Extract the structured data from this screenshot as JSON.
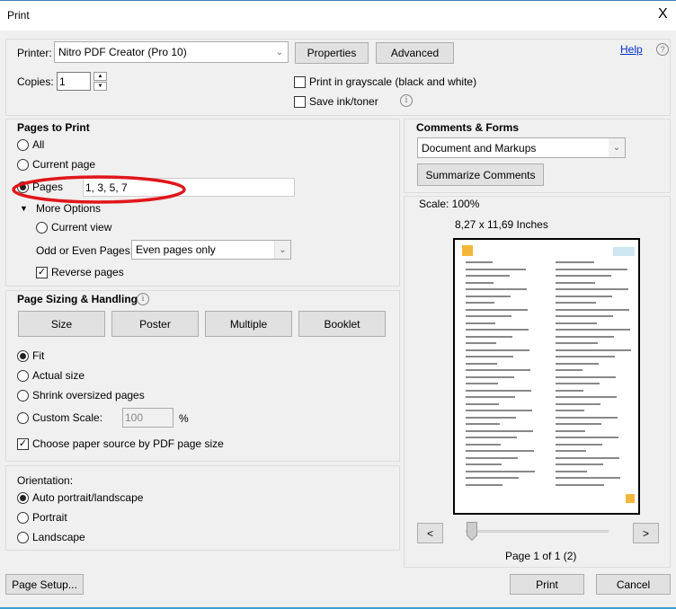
{
  "window": {
    "title": "Print",
    "close": "X"
  },
  "printer": {
    "label": "Printer:",
    "value": "Nitro PDF Creator (Pro 10)",
    "properties": "Properties",
    "advanced": "Advanced",
    "help": "Help"
  },
  "copies": {
    "label": "Copies:",
    "value": "1"
  },
  "options": {
    "grayscale": {
      "label": "Print in grayscale (black and white)",
      "checked": false
    },
    "save_ink": {
      "label": "Save ink/toner",
      "checked": false
    }
  },
  "pages_to_print": {
    "title": "Pages to Print",
    "all": "All",
    "current_page": "Current page",
    "pages": "Pages",
    "pages_value": "1, 3, 5, 7",
    "selected": "pages",
    "more_options": "More Options",
    "current_view": "Current view",
    "odd_even_label": "Odd or Even Pages:",
    "odd_even_value": "Even pages only",
    "reverse": "Reverse pages",
    "reverse_checked": true,
    "annotation_color": "#e0161b"
  },
  "sizing": {
    "title": "Page Sizing & Handling",
    "buttons": [
      "Size",
      "Poster",
      "Multiple",
      "Booklet"
    ],
    "fit": "Fit",
    "actual": "Actual size",
    "shrink": "Shrink oversized pages",
    "custom": "Custom Scale:",
    "custom_value": "100",
    "percent": "%",
    "selected": "fit",
    "paper_source": "Choose paper source by PDF page size",
    "paper_source_checked": true
  },
  "orientation": {
    "title": "Orientation:",
    "auto": "Auto portrait/landscape",
    "portrait": "Portrait",
    "landscape": "Landscape",
    "selected": "auto"
  },
  "comments": {
    "title": "Comments & Forms",
    "value": "Document and Markups",
    "summarize": "Summarize Comments"
  },
  "preview": {
    "scale": "Scale: 100%",
    "size": "8,27 x 11,69 Inches",
    "prev": "<",
    "next": ">",
    "page_label": "Page 1 of 1 (2)",
    "slider_position": 0
  },
  "footer": {
    "page_setup": "Page Setup...",
    "print": "Print",
    "cancel": "Cancel"
  }
}
